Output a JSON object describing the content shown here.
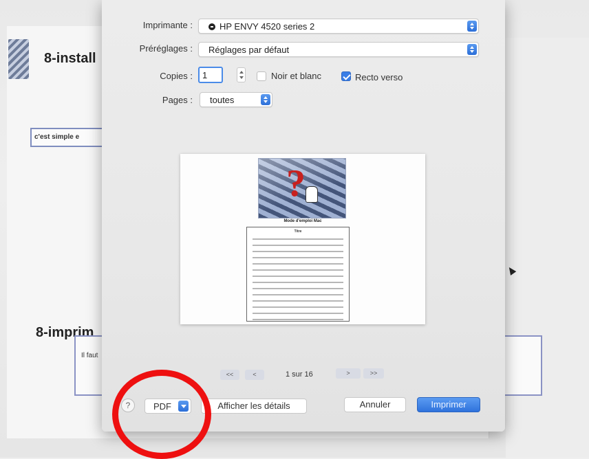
{
  "background_doc": {
    "heading_top": "8-install",
    "box_text": "c'est simple e",
    "heading_bottom": "8-imprim",
    "box2_text": "Il faut"
  },
  "dialog": {
    "printer_label": "Imprimante :",
    "printer_value": "HP ENVY 4520 series 2",
    "presets_label": "Préréglages :",
    "presets_value": "Réglages par défaut",
    "copies_label": "Copies :",
    "copies_value": "1",
    "bw_label": "Noir et blanc",
    "bw_checked": false,
    "duplex_label": "Recto verso",
    "duplex_checked": true,
    "pages_label": "Pages :",
    "pages_value": "toutes"
  },
  "preview": {
    "page_title": "Mode d'emploi Mac",
    "toc_heading": "Titre"
  },
  "pager": {
    "first": "<<",
    "prev": "<",
    "label": "1 sur 16",
    "next": ">",
    "last": ">>"
  },
  "footer": {
    "help": "?",
    "pdf": "PDF",
    "details": "Afficher les détails",
    "cancel": "Annuler",
    "print": "Imprimer"
  },
  "colors": {
    "accent": "#3a7ee6",
    "annotation": "#ee1010"
  }
}
